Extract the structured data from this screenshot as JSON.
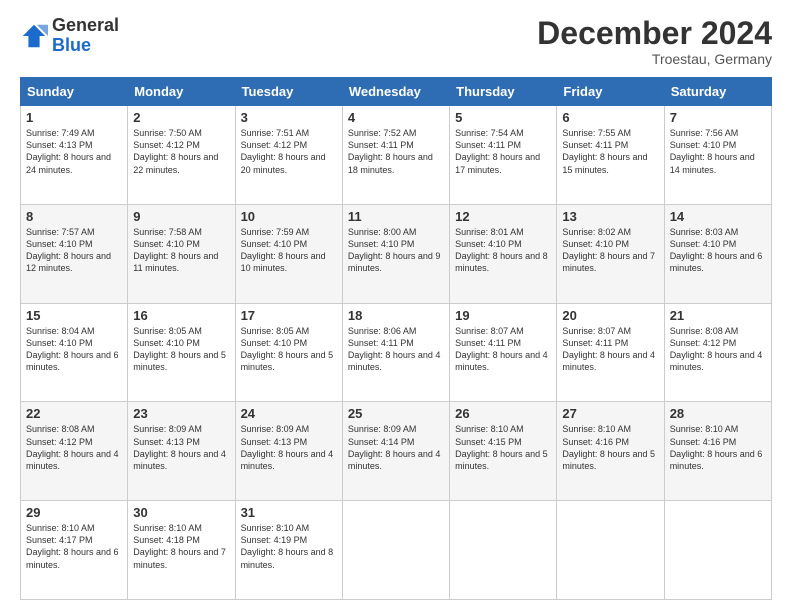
{
  "logo": {
    "general": "General",
    "blue": "Blue"
  },
  "header": {
    "month": "December 2024",
    "location": "Troestau, Germany"
  },
  "days_of_week": [
    "Sunday",
    "Monday",
    "Tuesday",
    "Wednesday",
    "Thursday",
    "Friday",
    "Saturday"
  ],
  "weeks": [
    [
      {
        "day": "1",
        "sunrise": "7:49 AM",
        "sunset": "4:13 PM",
        "daylight": "8 hours and 24 minutes."
      },
      {
        "day": "2",
        "sunrise": "7:50 AM",
        "sunset": "4:12 PM",
        "daylight": "8 hours and 22 minutes."
      },
      {
        "day": "3",
        "sunrise": "7:51 AM",
        "sunset": "4:12 PM",
        "daylight": "8 hours and 20 minutes."
      },
      {
        "day": "4",
        "sunrise": "7:52 AM",
        "sunset": "4:11 PM",
        "daylight": "8 hours and 18 minutes."
      },
      {
        "day": "5",
        "sunrise": "7:54 AM",
        "sunset": "4:11 PM",
        "daylight": "8 hours and 17 minutes."
      },
      {
        "day": "6",
        "sunrise": "7:55 AM",
        "sunset": "4:11 PM",
        "daylight": "8 hours and 15 minutes."
      },
      {
        "day": "7",
        "sunrise": "7:56 AM",
        "sunset": "4:10 PM",
        "daylight": "8 hours and 14 minutes."
      }
    ],
    [
      {
        "day": "8",
        "sunrise": "7:57 AM",
        "sunset": "4:10 PM",
        "daylight": "8 hours and 12 minutes."
      },
      {
        "day": "9",
        "sunrise": "7:58 AM",
        "sunset": "4:10 PM",
        "daylight": "8 hours and 11 minutes."
      },
      {
        "day": "10",
        "sunrise": "7:59 AM",
        "sunset": "4:10 PM",
        "daylight": "8 hours and 10 minutes."
      },
      {
        "day": "11",
        "sunrise": "8:00 AM",
        "sunset": "4:10 PM",
        "daylight": "8 hours and 9 minutes."
      },
      {
        "day": "12",
        "sunrise": "8:01 AM",
        "sunset": "4:10 PM",
        "daylight": "8 hours and 8 minutes."
      },
      {
        "day": "13",
        "sunrise": "8:02 AM",
        "sunset": "4:10 PM",
        "daylight": "8 hours and 7 minutes."
      },
      {
        "day": "14",
        "sunrise": "8:03 AM",
        "sunset": "4:10 PM",
        "daylight": "8 hours and 6 minutes."
      }
    ],
    [
      {
        "day": "15",
        "sunrise": "8:04 AM",
        "sunset": "4:10 PM",
        "daylight": "8 hours and 6 minutes."
      },
      {
        "day": "16",
        "sunrise": "8:05 AM",
        "sunset": "4:10 PM",
        "daylight": "8 hours and 5 minutes."
      },
      {
        "day": "17",
        "sunrise": "8:05 AM",
        "sunset": "4:10 PM",
        "daylight": "8 hours and 5 minutes."
      },
      {
        "day": "18",
        "sunrise": "8:06 AM",
        "sunset": "4:11 PM",
        "daylight": "8 hours and 4 minutes."
      },
      {
        "day": "19",
        "sunrise": "8:07 AM",
        "sunset": "4:11 PM",
        "daylight": "8 hours and 4 minutes."
      },
      {
        "day": "20",
        "sunrise": "8:07 AM",
        "sunset": "4:11 PM",
        "daylight": "8 hours and 4 minutes."
      },
      {
        "day": "21",
        "sunrise": "8:08 AM",
        "sunset": "4:12 PM",
        "daylight": "8 hours and 4 minutes."
      }
    ],
    [
      {
        "day": "22",
        "sunrise": "8:08 AM",
        "sunset": "4:12 PM",
        "daylight": "8 hours and 4 minutes."
      },
      {
        "day": "23",
        "sunrise": "8:09 AM",
        "sunset": "4:13 PM",
        "daylight": "8 hours and 4 minutes."
      },
      {
        "day": "24",
        "sunrise": "8:09 AM",
        "sunset": "4:13 PM",
        "daylight": "8 hours and 4 minutes."
      },
      {
        "day": "25",
        "sunrise": "8:09 AM",
        "sunset": "4:14 PM",
        "daylight": "8 hours and 4 minutes."
      },
      {
        "day": "26",
        "sunrise": "8:10 AM",
        "sunset": "4:15 PM",
        "daylight": "8 hours and 5 minutes."
      },
      {
        "day": "27",
        "sunrise": "8:10 AM",
        "sunset": "4:16 PM",
        "daylight": "8 hours and 5 minutes."
      },
      {
        "day": "28",
        "sunrise": "8:10 AM",
        "sunset": "4:16 PM",
        "daylight": "8 hours and 6 minutes."
      }
    ],
    [
      {
        "day": "29",
        "sunrise": "8:10 AM",
        "sunset": "4:17 PM",
        "daylight": "8 hours and 6 minutes."
      },
      {
        "day": "30",
        "sunrise": "8:10 AM",
        "sunset": "4:18 PM",
        "daylight": "8 hours and 7 minutes."
      },
      {
        "day": "31",
        "sunrise": "8:10 AM",
        "sunset": "4:19 PM",
        "daylight": "8 hours and 8 minutes."
      },
      null,
      null,
      null,
      null
    ]
  ]
}
